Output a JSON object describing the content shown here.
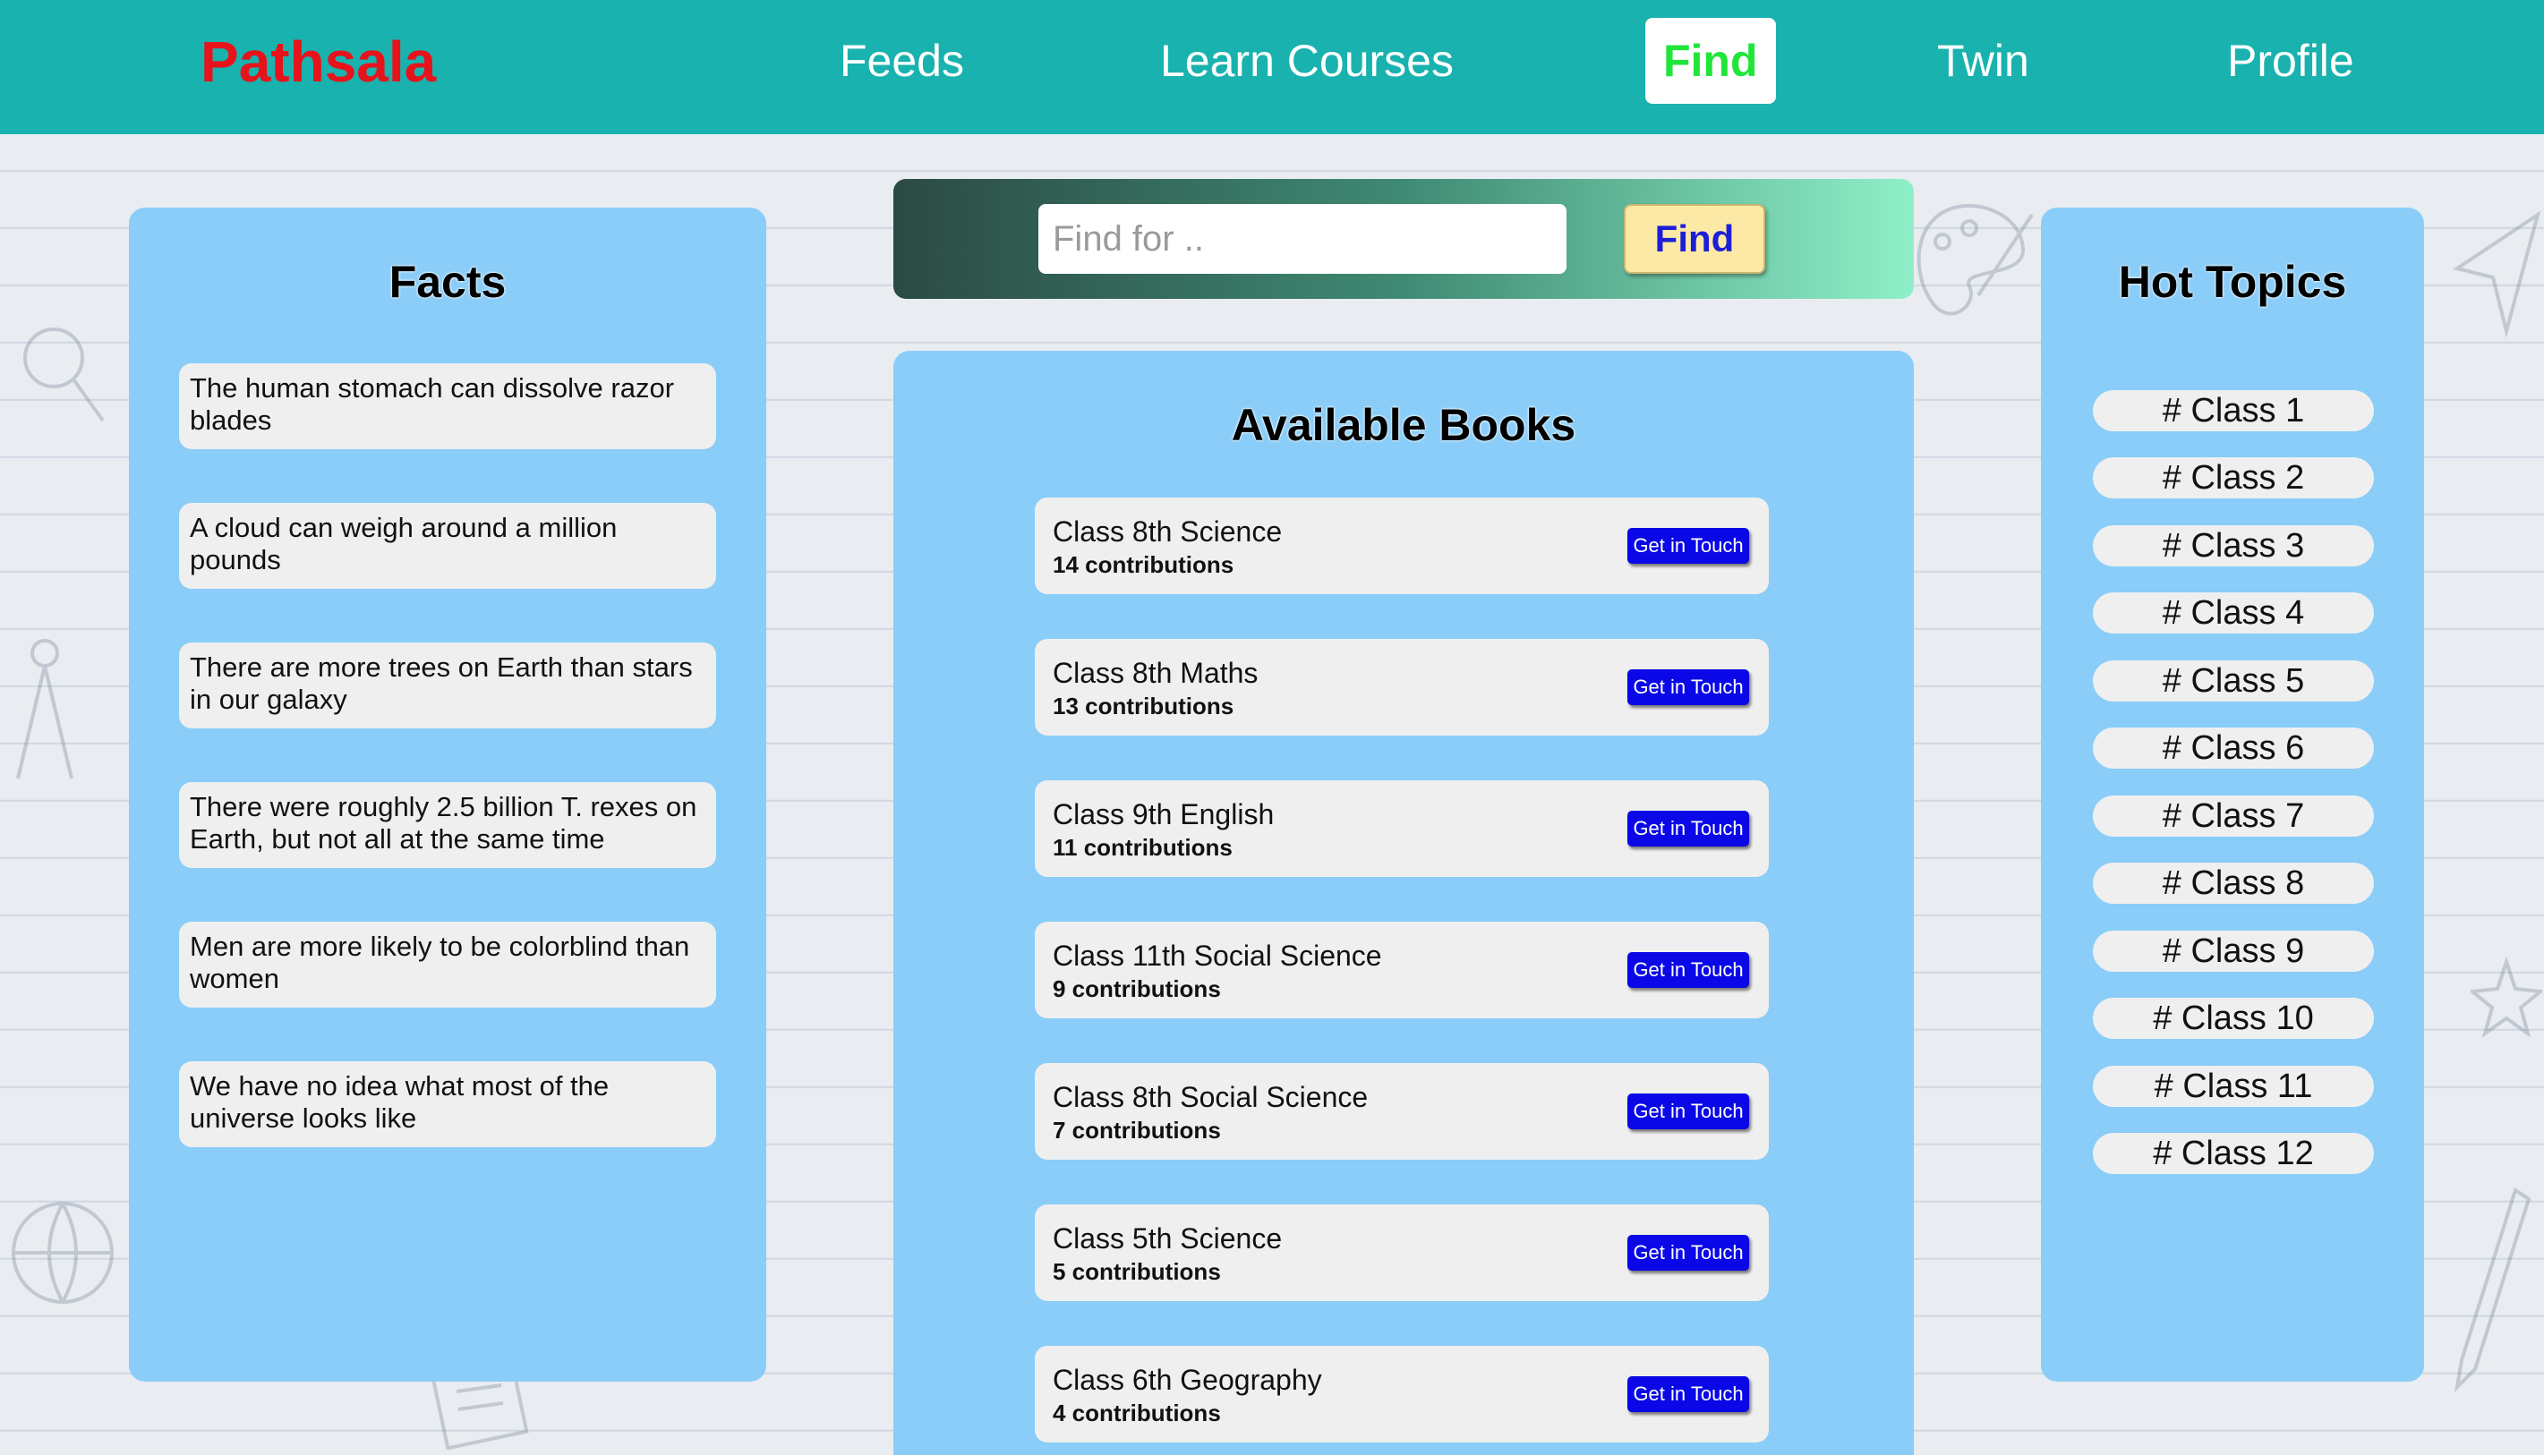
{
  "nav": {
    "brand": "Pathsala",
    "items": [
      {
        "label": "Feeds"
      },
      {
        "label": "Learn Courses"
      },
      {
        "label": "Find"
      },
      {
        "label": "Twin"
      },
      {
        "label": "Profile"
      }
    ]
  },
  "facts": {
    "title": "Facts",
    "items": [
      "The human stomach can dissolve razor blades",
      "A cloud can weigh around a million pounds",
      "There are more trees on Earth than stars in our galaxy",
      "There were roughly 2.5 billion T. rexes on Earth, but not all at the same time",
      "Men are more likely to be colorblind than women",
      "We have no idea what most of the universe looks like"
    ]
  },
  "search": {
    "placeholder": "Find for ..",
    "button_label": "Find"
  },
  "books": {
    "title": "Available Books",
    "button_label": "Get in Touch",
    "items": [
      {
        "title": "Class 8th Science",
        "contributions": "14 contributions"
      },
      {
        "title": "Class 8th Maths",
        "contributions": "13 contributions"
      },
      {
        "title": "Class 9th English",
        "contributions": "11 contributions"
      },
      {
        "title": "Class 11th Social Science",
        "contributions": "9 contributions"
      },
      {
        "title": "Class 8th Social Science",
        "contributions": "7 contributions"
      },
      {
        "title": "Class 5th Science",
        "contributions": "5 contributions"
      },
      {
        "title": "Class 6th Geography",
        "contributions": "4 contributions"
      }
    ]
  },
  "topics": {
    "title": "Hot Topics",
    "items": [
      "# Class 1",
      "# Class 2",
      "# Class 3",
      "# Class 4",
      "# Class 5",
      "# Class 6",
      "# Class 7",
      "# Class 8",
      "# Class 9",
      "# Class 10",
      "# Class 11",
      "# Class 12"
    ]
  },
  "colors": {
    "navbar": "#19b2ae",
    "brand": "#e8121b",
    "active_nav": "#21e53a",
    "panel": "#89cdf8",
    "button_blue": "#0a08e6"
  }
}
